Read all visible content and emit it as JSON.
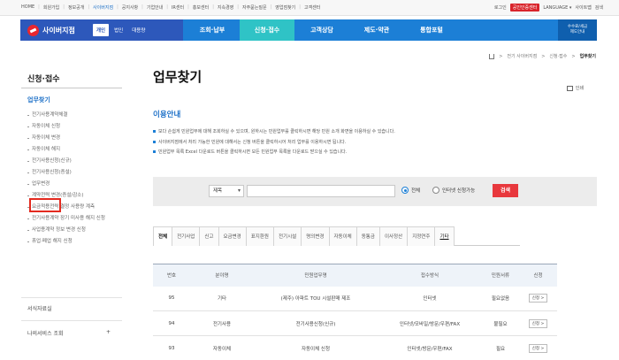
{
  "topbar": {
    "links": [
      "HOME",
      "회원가입",
      "정보공개",
      "사이버지점",
      "공지사항",
      "기업안내",
      "IR센터",
      "홍보센터",
      "지속경영",
      "자주묻는질문",
      "영업점찾기",
      "고객센터"
    ],
    "current": "사이버지점",
    "right_links": [
      "로그인",
      "인증센터",
      "LANGUAGE ▾",
      "사이트맵",
      "검색"
    ],
    "red_badge": "공인인증센터"
  },
  "nav": {
    "brand": "사이버지점",
    "customer_types": [
      "개인",
      "법인",
      "대용량"
    ],
    "active_customer_type": "개인",
    "menu": [
      "조회·납부",
      "신청·접수",
      "고객상담",
      "제도·약관",
      "통합포털"
    ],
    "active_menu": "신청·접수",
    "right_box": [
      "수수료/세금",
      "제도안내"
    ]
  },
  "sidebar": {
    "title": "신청·접수",
    "sub_title": "업무찾기",
    "items": [
      "전기사용계약체결",
      "자동이체 신청",
      "자동이체 변경",
      "자동이체 해지",
      "전기사용신청(신규)",
      "전기사용신청(증설)",
      "업무변경",
      "계약전력 변경(증설/감소)",
      "요금적용전력 결정 사용량 계측",
      "전기사용계약 장기 미사용 해지 신청",
      "사업용계약 정보 변경 신청",
      "휴업·폐업 해지 신청"
    ],
    "highlighted_item": "업무변경",
    "section_a": "서식자료실",
    "section_b": "나의서비스 조회",
    "section_b_toggle": "+"
  },
  "breadcrumb": [
    "전기 사이버지점",
    "신청·접수",
    "업무찾기"
  ],
  "page": {
    "title": "업무찾기",
    "print_label": "인쇄"
  },
  "guide": {
    "title": "이용안내",
    "items": [
      "보다 손쉽게 민원업무에 대해 조회하실 수 있으며, 원하시는 민원업무를 클릭하시면 해당 민원 소개 화면을 이용하실 수 있습니다.",
      "사이버지점에서 처리 가능한 민원에 대해서는 신청 버튼을 클릭하시어 처리 업무를 이용하시면 됩니다.",
      "민원업무 목록 Excel 다운로드 버튼을 클릭하시면 모든 민원업무 목록을 다운로드 받으실 수 있습니다."
    ]
  },
  "search": {
    "select_value": "제목",
    "input_value": "",
    "radio_all": "전체",
    "radio_online": "인터넷 신청가능",
    "radio_selected": "전체",
    "button": "검색"
  },
  "tabs": [
    "전체",
    "전기사업",
    "신고",
    "요금변경",
    "표지환원",
    "전기시설",
    "명의변경",
    "자동이체",
    "동통금",
    "이사정산",
    "지정연주",
    "기타"
  ],
  "active_tab": "전체",
  "table": {
    "headers": [
      "번호",
      "분야명",
      "민원업무명",
      "접수방식",
      "민원서류",
      "신청"
    ],
    "rows": [
      {
        "no": "95",
        "category": "기타",
        "title": "(제주) 아파트 TOU 시설판매 제조",
        "method": "인터넷",
        "doc": "필요없음",
        "status_red": false,
        "action": "신청 >"
      },
      {
        "no": "94",
        "category": "전기사용",
        "title": "전기사용신청(신규)",
        "method": "인터넷/모바일/방문/우편/FAX",
        "doc": "불필요",
        "status_red": false,
        "action": "신청 >"
      },
      {
        "no": "93",
        "category": "자동이체",
        "title": "자동이체 신청",
        "method": "인터넷/방문/우편/FAX",
        "doc": "필요",
        "status_red": true,
        "action": "신청 >"
      }
    ]
  },
  "colors": {
    "nav_blue": "#1c7fd6",
    "brand_blue": "#2d58bb",
    "active_teal": "#2fc3c6",
    "search_red": "#e8383d",
    "highlight_red": "#e32a1f"
  }
}
